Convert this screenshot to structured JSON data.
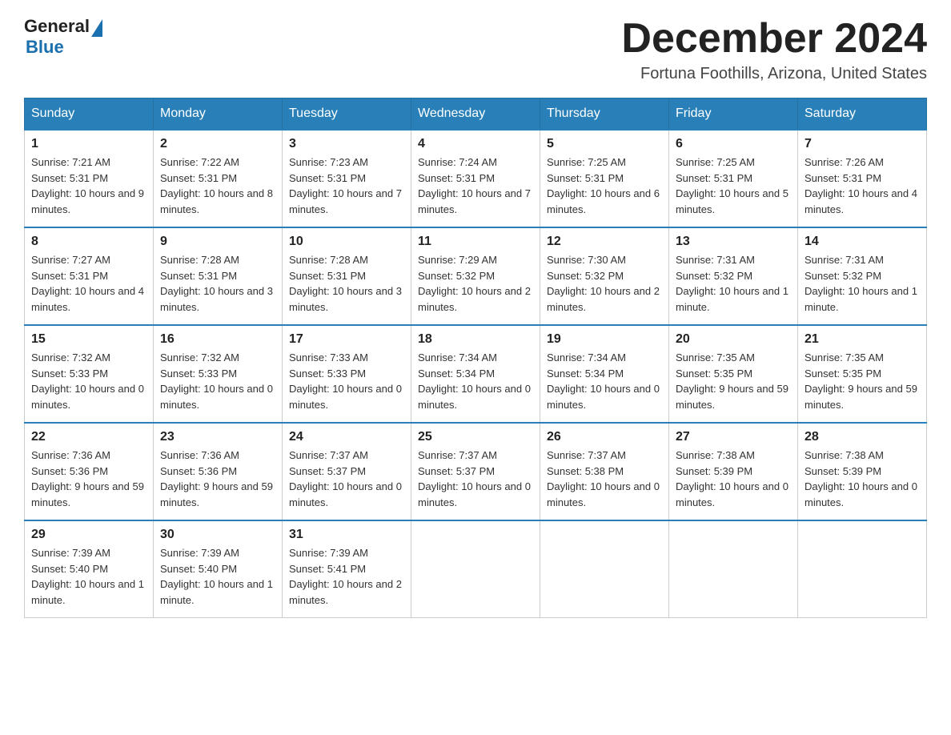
{
  "header": {
    "logo_general": "General",
    "logo_blue": "Blue",
    "month_year": "December 2024",
    "location": "Fortuna Foothills, Arizona, United States"
  },
  "weekdays": [
    "Sunday",
    "Monday",
    "Tuesday",
    "Wednesday",
    "Thursday",
    "Friday",
    "Saturday"
  ],
  "weeks": [
    [
      {
        "day": "1",
        "sunrise": "7:21 AM",
        "sunset": "5:31 PM",
        "daylight": "10 hours and 9 minutes."
      },
      {
        "day": "2",
        "sunrise": "7:22 AM",
        "sunset": "5:31 PM",
        "daylight": "10 hours and 8 minutes."
      },
      {
        "day": "3",
        "sunrise": "7:23 AM",
        "sunset": "5:31 PM",
        "daylight": "10 hours and 7 minutes."
      },
      {
        "day": "4",
        "sunrise": "7:24 AM",
        "sunset": "5:31 PM",
        "daylight": "10 hours and 7 minutes."
      },
      {
        "day": "5",
        "sunrise": "7:25 AM",
        "sunset": "5:31 PM",
        "daylight": "10 hours and 6 minutes."
      },
      {
        "day": "6",
        "sunrise": "7:25 AM",
        "sunset": "5:31 PM",
        "daylight": "10 hours and 5 minutes."
      },
      {
        "day": "7",
        "sunrise": "7:26 AM",
        "sunset": "5:31 PM",
        "daylight": "10 hours and 4 minutes."
      }
    ],
    [
      {
        "day": "8",
        "sunrise": "7:27 AM",
        "sunset": "5:31 PM",
        "daylight": "10 hours and 4 minutes."
      },
      {
        "day": "9",
        "sunrise": "7:28 AM",
        "sunset": "5:31 PM",
        "daylight": "10 hours and 3 minutes."
      },
      {
        "day": "10",
        "sunrise": "7:28 AM",
        "sunset": "5:31 PM",
        "daylight": "10 hours and 3 minutes."
      },
      {
        "day": "11",
        "sunrise": "7:29 AM",
        "sunset": "5:32 PM",
        "daylight": "10 hours and 2 minutes."
      },
      {
        "day": "12",
        "sunrise": "7:30 AM",
        "sunset": "5:32 PM",
        "daylight": "10 hours and 2 minutes."
      },
      {
        "day": "13",
        "sunrise": "7:31 AM",
        "sunset": "5:32 PM",
        "daylight": "10 hours and 1 minute."
      },
      {
        "day": "14",
        "sunrise": "7:31 AM",
        "sunset": "5:32 PM",
        "daylight": "10 hours and 1 minute."
      }
    ],
    [
      {
        "day": "15",
        "sunrise": "7:32 AM",
        "sunset": "5:33 PM",
        "daylight": "10 hours and 0 minutes."
      },
      {
        "day": "16",
        "sunrise": "7:32 AM",
        "sunset": "5:33 PM",
        "daylight": "10 hours and 0 minutes."
      },
      {
        "day": "17",
        "sunrise": "7:33 AM",
        "sunset": "5:33 PM",
        "daylight": "10 hours and 0 minutes."
      },
      {
        "day": "18",
        "sunrise": "7:34 AM",
        "sunset": "5:34 PM",
        "daylight": "10 hours and 0 minutes."
      },
      {
        "day": "19",
        "sunrise": "7:34 AM",
        "sunset": "5:34 PM",
        "daylight": "10 hours and 0 minutes."
      },
      {
        "day": "20",
        "sunrise": "7:35 AM",
        "sunset": "5:35 PM",
        "daylight": "9 hours and 59 minutes."
      },
      {
        "day": "21",
        "sunrise": "7:35 AM",
        "sunset": "5:35 PM",
        "daylight": "9 hours and 59 minutes."
      }
    ],
    [
      {
        "day": "22",
        "sunrise": "7:36 AM",
        "sunset": "5:36 PM",
        "daylight": "9 hours and 59 minutes."
      },
      {
        "day": "23",
        "sunrise": "7:36 AM",
        "sunset": "5:36 PM",
        "daylight": "9 hours and 59 minutes."
      },
      {
        "day": "24",
        "sunrise": "7:37 AM",
        "sunset": "5:37 PM",
        "daylight": "10 hours and 0 minutes."
      },
      {
        "day": "25",
        "sunrise": "7:37 AM",
        "sunset": "5:37 PM",
        "daylight": "10 hours and 0 minutes."
      },
      {
        "day": "26",
        "sunrise": "7:37 AM",
        "sunset": "5:38 PM",
        "daylight": "10 hours and 0 minutes."
      },
      {
        "day": "27",
        "sunrise": "7:38 AM",
        "sunset": "5:39 PM",
        "daylight": "10 hours and 0 minutes."
      },
      {
        "day": "28",
        "sunrise": "7:38 AM",
        "sunset": "5:39 PM",
        "daylight": "10 hours and 0 minutes."
      }
    ],
    [
      {
        "day": "29",
        "sunrise": "7:39 AM",
        "sunset": "5:40 PM",
        "daylight": "10 hours and 1 minute."
      },
      {
        "day": "30",
        "sunrise": "7:39 AM",
        "sunset": "5:40 PM",
        "daylight": "10 hours and 1 minute."
      },
      {
        "day": "31",
        "sunrise": "7:39 AM",
        "sunset": "5:41 PM",
        "daylight": "10 hours and 2 minutes."
      },
      null,
      null,
      null,
      null
    ]
  ],
  "labels": {
    "sunrise": "Sunrise:",
    "sunset": "Sunset:",
    "daylight": "Daylight:"
  }
}
